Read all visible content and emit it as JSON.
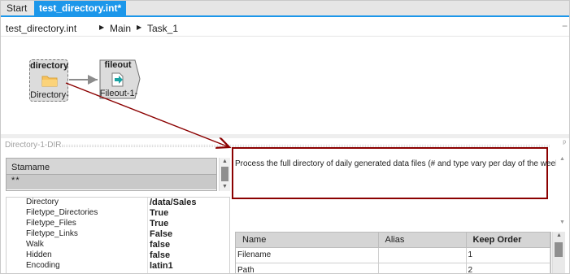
{
  "tabs": [
    {
      "label": "Start",
      "active": false
    },
    {
      "label": "test_directory.int*",
      "active": true,
      "close": "✕"
    }
  ],
  "breadcrumb": {
    "items": [
      "test_directory.int",
      "Main",
      "Task_1"
    ],
    "separator": "▶",
    "collapse": "−"
  },
  "canvas": {
    "nodes": [
      {
        "id": "directory",
        "title": "directory",
        "label": "Directory-",
        "icon": "folder-icon"
      },
      {
        "id": "fileout",
        "title": "fileout",
        "label": "Fileout-1-",
        "icon": "file-arrow-icon"
      }
    ]
  },
  "properties_panel": {
    "title": "Directory-1-DIR",
    "pin": "ᵖ"
  },
  "stamp_grid": {
    "header": "Stamame",
    "row": "* *"
  },
  "properties": [
    {
      "key": "Directory",
      "value": "/data/Sales"
    },
    {
      "key": "Filetype_Directories",
      "value": "True"
    },
    {
      "key": "Filetype_Files",
      "value": "True"
    },
    {
      "key": "Filetype_Links",
      "value": "False"
    },
    {
      "key": "Walk",
      "value": "false"
    },
    {
      "key": "Hidden",
      "value": "false"
    },
    {
      "key": "Encoding",
      "value": "latin1"
    }
  ],
  "description": {
    "text": "Process the full directory of daily generated data files (# and type vary per day of the week)."
  },
  "columns_table": {
    "headers": [
      "Name",
      "Alias",
      "Keep Order"
    ],
    "rows": [
      [
        "Filename",
        "",
        "1"
      ],
      [
        "Path",
        "",
        "2"
      ]
    ]
  },
  "colors": {
    "accent": "#1c97ea",
    "annotation": "#8b0000",
    "folder": "#f7c25d",
    "file_arrow": "#1aa3a3"
  }
}
